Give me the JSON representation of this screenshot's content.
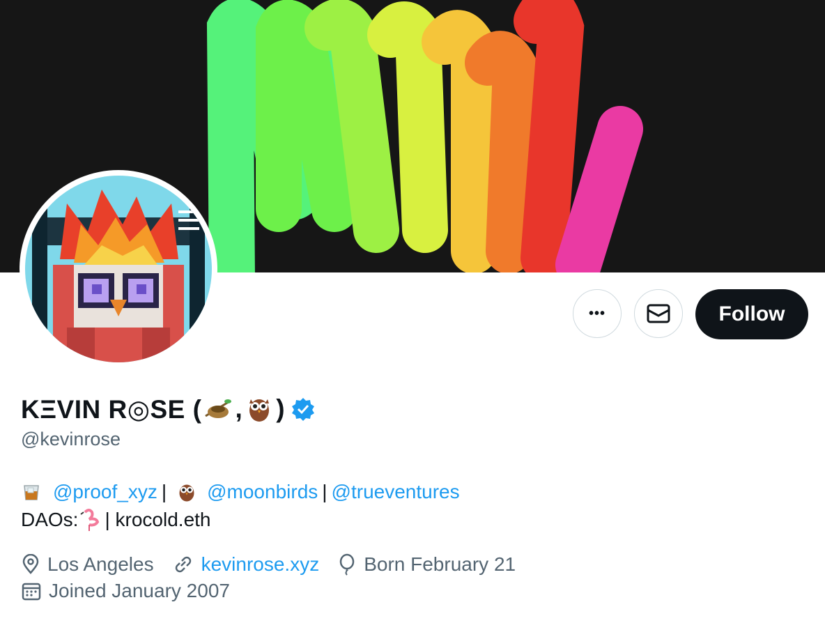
{
  "profile": {
    "display_name": "KΞVIN R◎SE (",
    "display_name_sep": ",",
    "display_name_end": ")",
    "handle": "@kevinrose",
    "verified": true
  },
  "actions": {
    "more_label": "•••",
    "message_icon": "mail-icon",
    "follow_label": "Follow"
  },
  "bio": {
    "line1": {
      "mention1": "@proof_xyz",
      "sep1": "|",
      "mention2": "@moonbirds",
      "sep2": "|",
      "mention3": "@trueventures"
    },
    "line2": {
      "prefix": "DAOs:",
      "suffix": "| krocold.eth"
    }
  },
  "meta": {
    "location": "Los Angeles",
    "website": "kevinrose.xyz",
    "birthday": "Born February 21",
    "joined": "Joined January 2007"
  },
  "colors": {
    "accent": "#1d9bf0",
    "text": "#0f1419",
    "secondary": "#536471",
    "banner_bg": "#161616"
  }
}
